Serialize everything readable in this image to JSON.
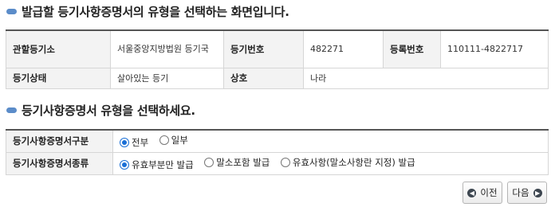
{
  "section1": {
    "title": "발급할 등기사항증명서의 유형을 선택하는 화면입니다."
  },
  "info_table": {
    "registry_office_label": "관할등기소",
    "registry_office_value": "서울중앙지방법원 등기국",
    "registration_number_label": "등기번호",
    "registration_number_value": "482271",
    "reg_no_label": "등록번호",
    "reg_no_value": "110111-4822717",
    "status_label": "등기상태",
    "status_value": "살아있는 등기",
    "trade_name_label": "상호",
    "trade_name_value": "나라"
  },
  "section2": {
    "title": "등기사항증명서 유형을 선택하세요."
  },
  "type_table": {
    "scope_label": "등기사항증명서구분",
    "scope_options": [
      {
        "label": "전부",
        "selected": true
      },
      {
        "label": "일부",
        "selected": false
      }
    ],
    "kind_label": "등기사항증명서종류",
    "kind_options": [
      {
        "label": "유효부분만 발급",
        "selected": true
      },
      {
        "label": "말소포함 발급",
        "selected": false
      },
      {
        "label": "유효사항(말소사항란 지정) 발급",
        "selected": false
      }
    ]
  },
  "buttons": {
    "prev_label": "이전",
    "next_label": "다음",
    "prev_icon": "chevron-left-circle-icon",
    "next_icon": "chevron-right-circle-icon"
  },
  "colors": {
    "accent": "#1a6fd6",
    "header_bullet": "#5b8cc9",
    "header_bg": "#f3f3f3"
  }
}
